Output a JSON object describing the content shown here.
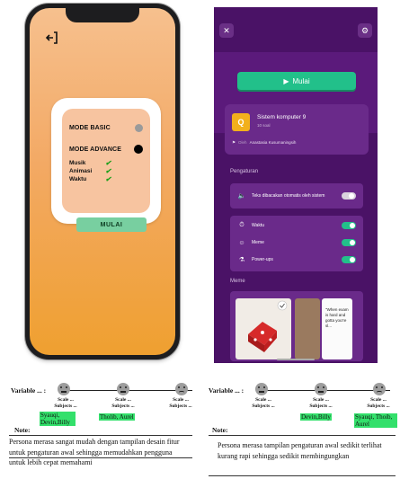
{
  "left_phone": {
    "mode_basic": "MODE BASIC",
    "mode_advance": "MODE ADVANCE",
    "features": [
      "Musik",
      "Animasi",
      "Waktu"
    ],
    "check_glyph": "✔",
    "start_label": "MULAI",
    "back_icon": "exit-icon"
  },
  "right_app": {
    "mulai_label": "Mulai",
    "quiz_title": "Sistem komputer 9",
    "quiz_count": "10 soal",
    "author_prefix": "Oleh",
    "author_name": "Anastasia Kusumaningsih",
    "quiz_initial": "Q",
    "section_settings": "Pengaturan",
    "tts_label": "Teks dibacakan otomatis oleh sistem",
    "options": [
      {
        "label": "Waktu",
        "icon": "timer-icon",
        "on": true
      },
      {
        "label": "Meme",
        "icon": "meme-icon",
        "on": true
      },
      {
        "label": "Power-ups",
        "icon": "powerup-icon",
        "on": true
      }
    ],
    "section_meme": "Meme",
    "meme_text": "\"When exam is hard and gotta you're sl..."
  },
  "variable_left": {
    "label": "Variable ... :",
    "caption_scale": "Scale ...",
    "caption_subjects": "Subjects ...",
    "tags": [
      "Syauqi, Devin,Billy",
      "Tholib, Aurel"
    ],
    "note_label": "Note:",
    "note_text": "Persona merasa sangat mudah dengan tampilan desain fitur untuk pengaturan awal sehingga memudahkan pengguna untuk lebih cepat memahami"
  },
  "variable_right": {
    "label": "Variable ... :",
    "caption_scale": "Scale ...",
    "caption_subjects": "Subjects ...",
    "tags": [
      "Devin,Billy",
      "Syauqi, Thoib, Aurel"
    ],
    "note_label": "Note:",
    "note_text": "Persona merasa tampilan pengaturan awal sedikit terlihat kurang rapi sehingga sedikit membingungkan"
  }
}
